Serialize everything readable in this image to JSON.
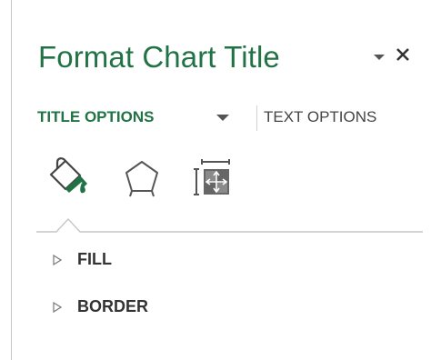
{
  "pane": {
    "title": "Format Chart Title",
    "dropdown_icon": "chevron-down-icon",
    "close_icon": "close-icon"
  },
  "tabs": [
    {
      "label": "TITLE OPTIONS",
      "active": true,
      "has_dropdown": true
    },
    {
      "label": "TEXT OPTIONS",
      "active": false
    }
  ],
  "option_icons": [
    "paint-bucket-icon",
    "pentagon-icon",
    "size-properties-icon"
  ],
  "sections": [
    {
      "label": "FILL",
      "expanded": false
    },
    {
      "label": "BORDER",
      "expanded": false
    }
  ],
  "colors": {
    "accent": "#217346",
    "text": "#444444",
    "divider": "#c6c6c6"
  }
}
